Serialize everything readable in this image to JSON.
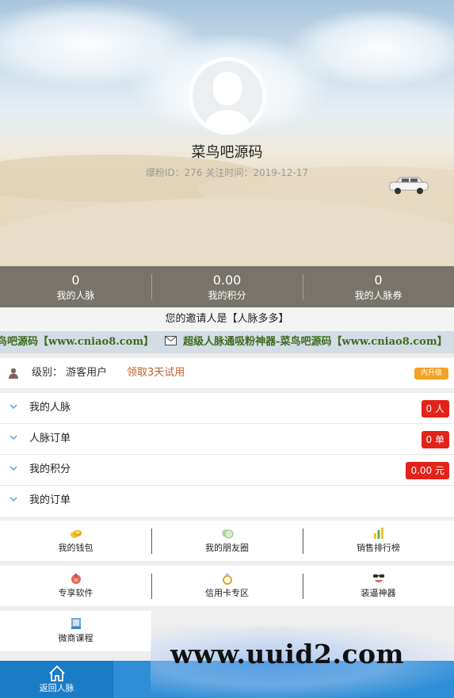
{
  "profile": {
    "nickname": "菜鸟吧源码",
    "meta": "爆粉ID：276   关注时间：2019-12-17"
  },
  "stats": [
    {
      "value": "0",
      "label": "我的人脉"
    },
    {
      "value": "0.00",
      "label": "我的积分"
    },
    {
      "value": "0",
      "label": "我的人脉券"
    }
  ],
  "inviter": "您的邀请人是【人脉多多】",
  "marquee": {
    "text_before": "鸟吧源码【www.cniao8.com】",
    "text_after": "超级人脉通吸粉神器-菜鸟吧源码【www.cniao8.com】"
  },
  "level": {
    "text": "级别：  游客用户",
    "trial_link": "领取3天试用",
    "upgrade_label": "内升级"
  },
  "menu": [
    {
      "label": "我的人脉",
      "badge": "0 人"
    },
    {
      "label": "人脉订单",
      "badge": "0 单"
    },
    {
      "label": "我的积分",
      "badge": "0.00 元"
    },
    {
      "label": "我的订单",
      "badge": ""
    }
  ],
  "grid": [
    [
      {
        "label": "我的钱包",
        "icon": "wallet-icon"
      },
      {
        "label": "我的朋友圈",
        "icon": "moments-icon"
      },
      {
        "label": "销售排行榜",
        "icon": "ranking-icon"
      }
    ],
    [
      {
        "label": "专享软件",
        "icon": "software-icon"
      },
      {
        "label": "信用卡专区",
        "icon": "credit-card-icon"
      },
      {
        "label": "装逼神器",
        "icon": "fun-tool-icon"
      }
    ],
    [
      {
        "label": "微商课程",
        "icon": "course-icon"
      }
    ]
  ],
  "tabbar": [
    {
      "label": "返回人脉",
      "icon": "home-icon",
      "active": true
    },
    {
      "label": "",
      "icon": "tab-icon"
    },
    {
      "label": "",
      "icon": "tab-icon"
    },
    {
      "label": "",
      "icon": "tab-icon"
    }
  ],
  "watermark": "www.uuid2.com",
  "colors": {
    "accent_blue": "#2e8ed6",
    "badge_red": "#e2231a",
    "upgrade_orange": "#f3a224",
    "marquee_green": "#3d6b1e"
  }
}
